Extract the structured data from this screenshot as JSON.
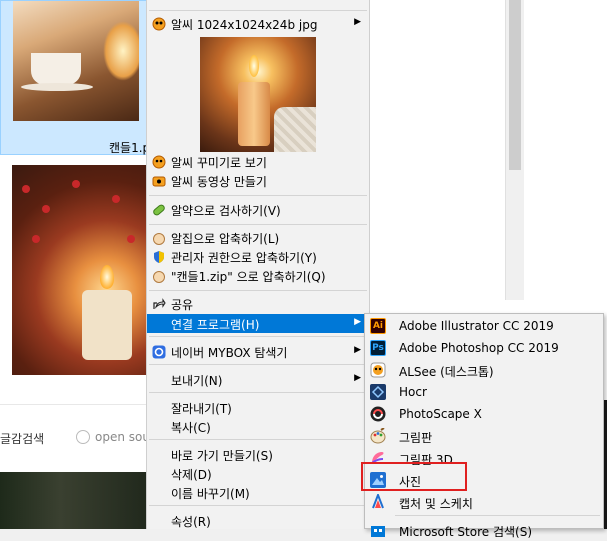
{
  "background": {
    "file_label": "캔들1.p",
    "footer_search_label": "글감검색",
    "footer_source_label": "open sour"
  },
  "context_menu": {
    "alsee_item": "알씨 1024x1024x24b jpg",
    "alsee_decorate": "알씨 꾸미기로 보기",
    "alsee_video": "알씨 동영상 만들기",
    "alyac_scan": "알약으로 검사하기(V)",
    "alzip_compress": "알집으로 압축하기(L)",
    "admin_compress": "관리자 권한으로 압축하기(Y)",
    "zip_compress": "\"캔들1.zip\" 으로 압축하기(Q)",
    "share": "공유",
    "open_with": "연결 프로그램(H)",
    "naver_mybox": "네이버 MYBOX 탐색기",
    "send_to": "보내기(N)",
    "cut": "잘라내기(T)",
    "copy": "복사(C)",
    "create_shortcut": "바로 가기 만들기(S)",
    "delete": "삭제(D)",
    "rename": "이름 바꾸기(M)",
    "properties": "속성(R)"
  },
  "open_with_menu": {
    "items": [
      {
        "label": "Adobe Illustrator CC 2019",
        "icon": "illustrator-icon",
        "icon_text": "Ai",
        "bg": "#330000",
        "fg": "#ff9a00"
      },
      {
        "label": "Adobe Photoshop CC 2019",
        "icon": "photoshop-icon",
        "icon_text": "Ps",
        "bg": "#001e36",
        "fg": "#31a8ff"
      },
      {
        "label": "ALSee (데스크톱)",
        "icon": "alsee-icon",
        "icon_text": "",
        "bg": "#ffffff",
        "fg": "#000000"
      },
      {
        "label": "Hocr",
        "icon": "hocr-icon",
        "icon_text": "",
        "bg": "#1a3a6a",
        "fg": "#ffffff"
      },
      {
        "label": "PhotoScape X",
        "icon": "photoscape-icon",
        "icon_text": "",
        "bg": "#222222",
        "fg": "#ff5050"
      },
      {
        "label": "그림판",
        "icon": "paint-icon",
        "icon_text": "",
        "bg": "#f2f2f2",
        "fg": "#000000"
      },
      {
        "label": "그림판 3D",
        "icon": "paint3d-icon",
        "icon_text": "",
        "bg": "#f2f2f2",
        "fg": "#000000"
      },
      {
        "label": "사진",
        "icon": "photos-icon",
        "icon_text": "",
        "bg": "#1f6fd1",
        "fg": "#ffffff"
      },
      {
        "label": "캡처 및 스케치",
        "icon": "snip-sketch-icon",
        "icon_text": "",
        "bg": "#f2f2f2",
        "fg": "#000000"
      },
      {
        "label": "Microsoft Store 검색(S)",
        "icon": "store-icon",
        "icon_text": "",
        "bg": "#0078d7",
        "fg": "#ffffff"
      }
    ]
  },
  "colors": {
    "selection": "#0078d7",
    "highlight_box": "#e02020"
  }
}
